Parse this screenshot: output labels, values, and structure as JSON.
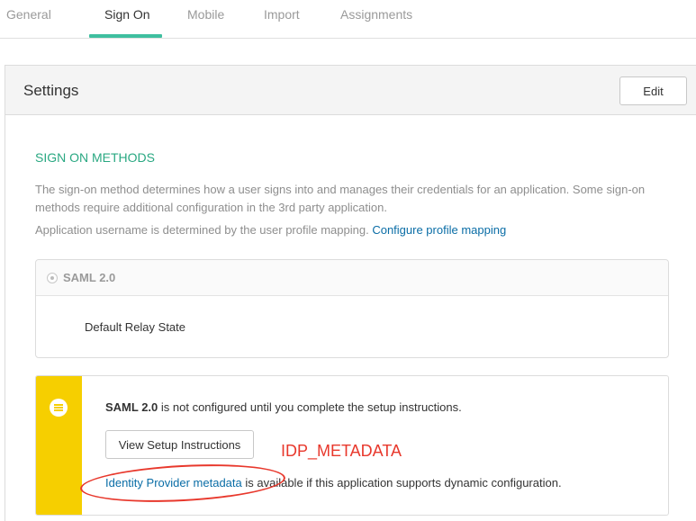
{
  "tabs": [
    {
      "label": "General",
      "active": false
    },
    {
      "label": "Sign On",
      "active": true
    },
    {
      "label": "Mobile",
      "active": false
    },
    {
      "label": "Import",
      "active": false
    },
    {
      "label": "Assignments",
      "active": false
    }
  ],
  "settings": {
    "title": "Settings",
    "edit_label": "Edit"
  },
  "sign_on": {
    "section_title": "SIGN ON METHODS",
    "description": "The sign-on method determines how a user signs into and manages their credentials for an application. Some sign-on methods require additional configuration in the 3rd party application.",
    "username_text": "Application username is determined by the user profile mapping.",
    "profile_link": "Configure profile mapping"
  },
  "saml": {
    "label": "SAML 2.0",
    "relay_state_label": "Default Relay State"
  },
  "notice": {
    "bold": "SAML 2.0",
    "text": " is not configured until you complete the setup instructions.",
    "button_label": "View Setup Instructions",
    "metadata_link": "Identity Provider metadata",
    "metadata_text": " is available if this application supports dynamic configuration.",
    "annotation": "IDP_METADATA"
  },
  "colors": {
    "accent": "#3fbf9f",
    "section_title": "#2aa882",
    "link": "#0a6da6",
    "notice_bar": "#f6cf00",
    "annotation": "#e8382c"
  },
  "icons": {
    "notice": "list-icon",
    "saml_radio": "radio-icon"
  }
}
